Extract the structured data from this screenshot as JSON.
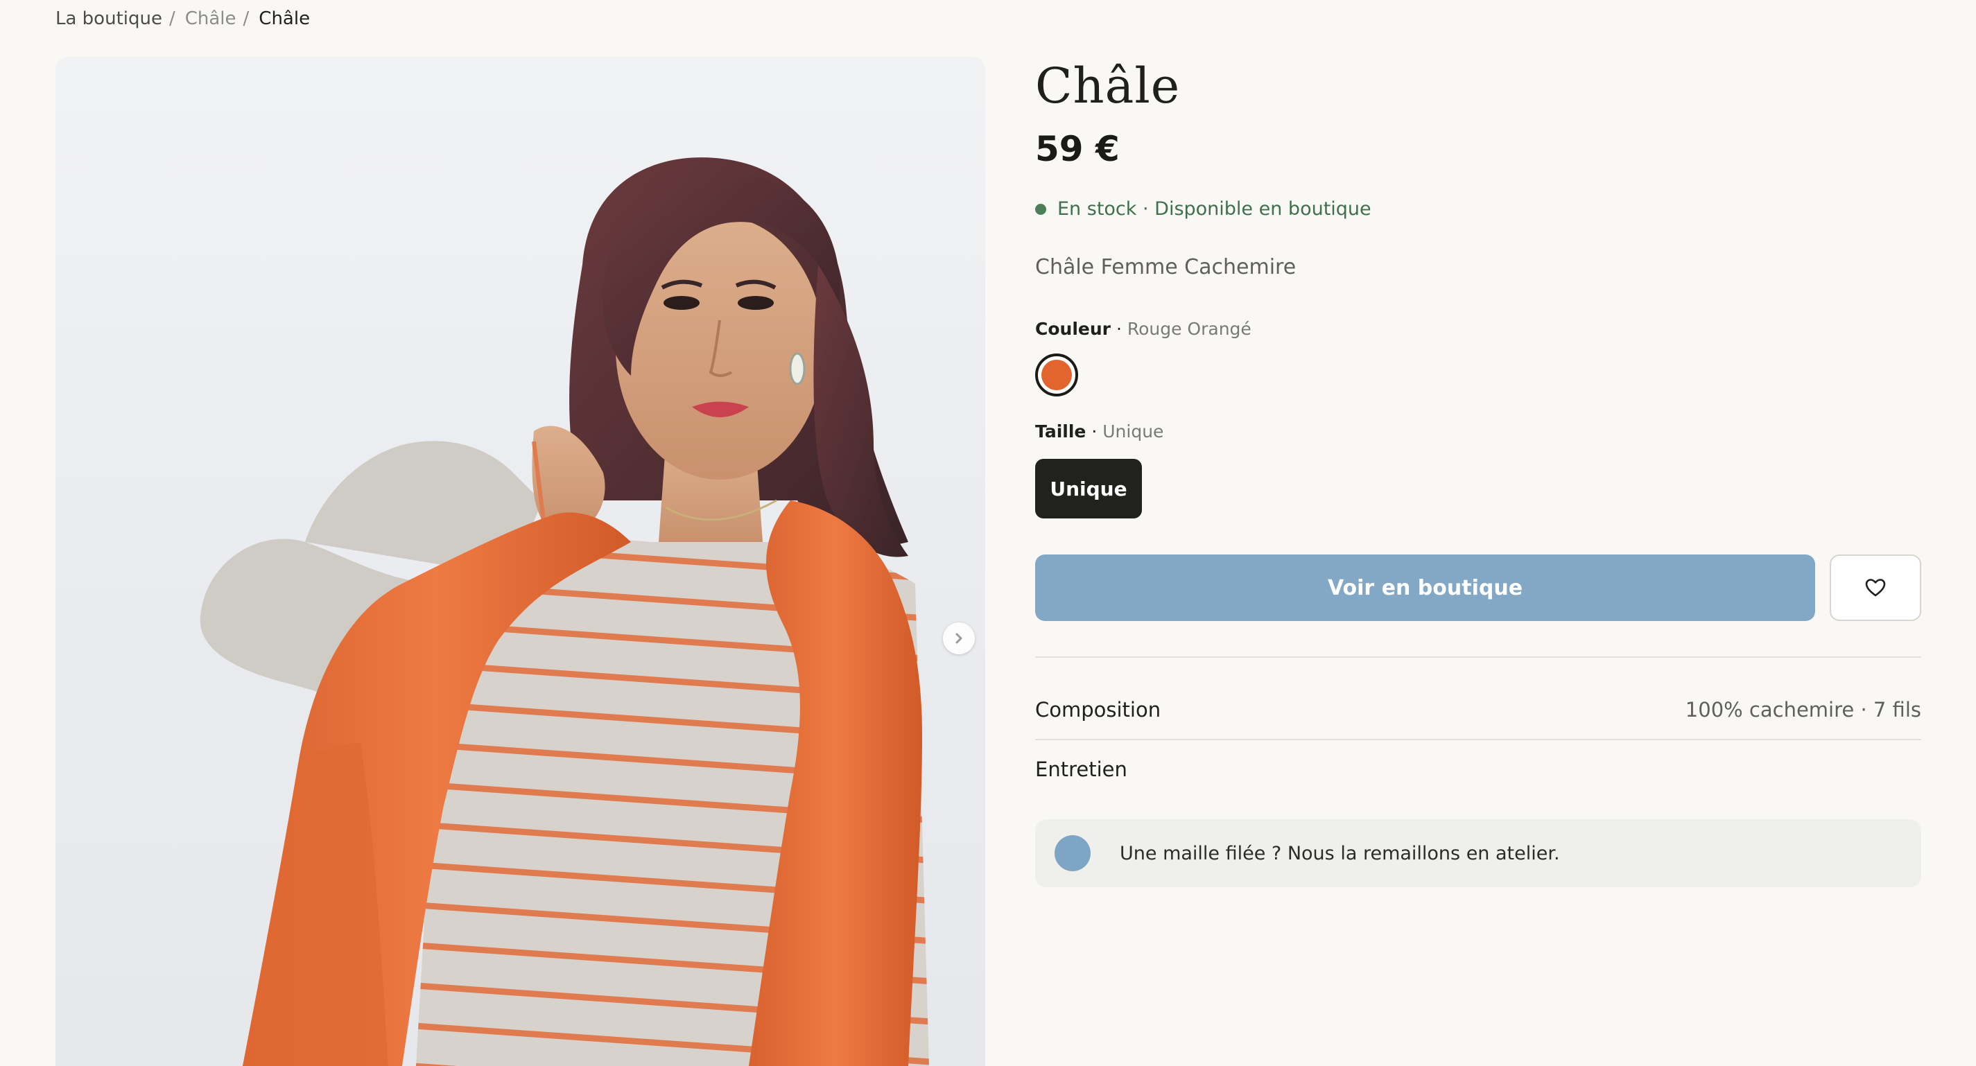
{
  "breadcrumb": {
    "items": [
      "La boutique",
      "Châle",
      "Châle"
    ],
    "separator": "/"
  },
  "product": {
    "title": "Châle",
    "price": "59 €",
    "stock": "En stock · Disponible en boutique",
    "subtitle": "Châle Femme Cachemire"
  },
  "color_option": {
    "label": "Couleur",
    "dot": "·",
    "value": "Rouge Orangé",
    "swatch": "#e2642f"
  },
  "size_option": {
    "label": "Taille",
    "dot": "·",
    "value": "Unique",
    "button_label": "Unique"
  },
  "cta": {
    "label": "Voir en boutique",
    "color": "#82a8c6",
    "wishlist_icon": "heart-icon"
  },
  "details": {
    "composition_label": "Composition",
    "composition_value": "100% cachemire · 7 fils",
    "care_label": "Entretien"
  },
  "notice": {
    "text": "Une maille filée ? Nous la remaillons en atelier."
  },
  "gallery": {
    "next_icon": "chevron-right-icon"
  }
}
